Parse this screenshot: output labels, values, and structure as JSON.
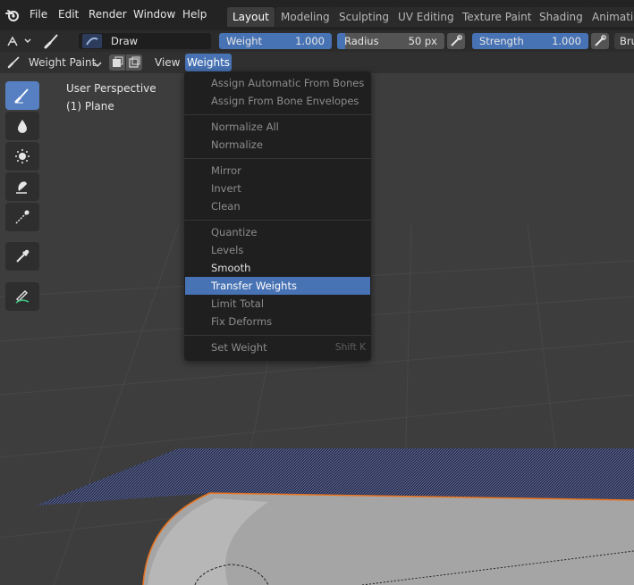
{
  "menubar": {
    "items": [
      "File",
      "Edit",
      "Render",
      "Window",
      "Help"
    ],
    "workspaces": [
      "Layout",
      "Modeling",
      "Sculpting",
      "UV Editing",
      "Texture Paint",
      "Shading",
      "Animatio"
    ],
    "active_workspace": "Layout"
  },
  "toolbar": {
    "brush_name": "Draw",
    "weight_label": "Weight",
    "weight_value": "1.000",
    "radius_label": "Radius",
    "radius_value": "50 px",
    "strength_label": "Strength",
    "strength_value": "1.000",
    "brush_menu": "Bru"
  },
  "header": {
    "mode": "Weight Paint",
    "view_menu": "View",
    "weights_menu": "Weights"
  },
  "viewport": {
    "perspective": "User Perspective",
    "object": "(1) Plane"
  },
  "weights_menu": {
    "groups": [
      [
        {
          "label": "Assign Automatic From Bones",
          "enabled": false
        },
        {
          "label": "Assign From Bone Envelopes",
          "enabled": false
        }
      ],
      [
        {
          "label": "Normalize All",
          "enabled": false
        },
        {
          "label": "Normalize",
          "enabled": false
        }
      ],
      [
        {
          "label": "Mirror",
          "enabled": false
        },
        {
          "label": "Invert",
          "enabled": false
        },
        {
          "label": "Clean",
          "enabled": false
        }
      ],
      [
        {
          "label": "Quantize",
          "enabled": false
        },
        {
          "label": "Levels",
          "enabled": false
        },
        {
          "label": "Smooth",
          "enabled": true
        },
        {
          "label": "Transfer Weights",
          "enabled": true,
          "highlighted": true
        },
        {
          "label": "Limit Total",
          "enabled": false
        },
        {
          "label": "Fix Deforms",
          "enabled": false
        }
      ],
      [
        {
          "label": "Set Weight",
          "enabled": false,
          "shortcut": "Shift K"
        }
      ]
    ]
  },
  "colors": {
    "accent": "#4772b3",
    "selection_outline": "#e8731e"
  }
}
